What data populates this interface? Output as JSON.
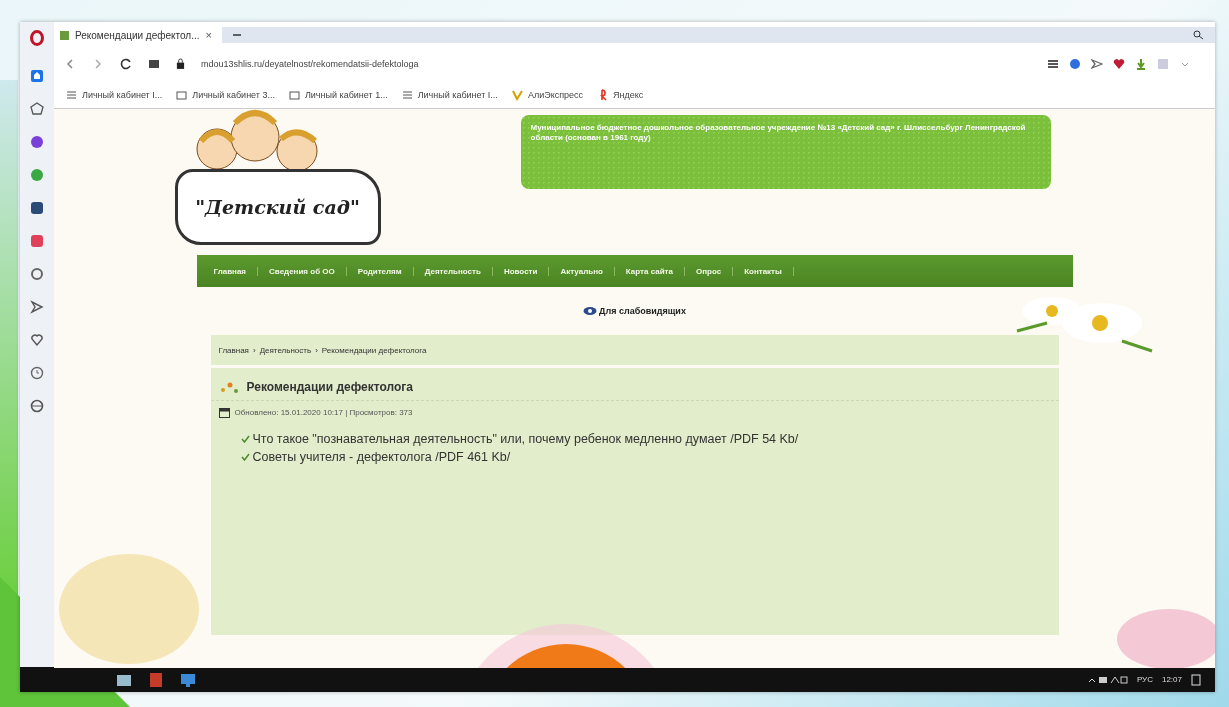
{
  "browser": {
    "tab": {
      "title": "Рекомендации дефектол...",
      "close": "×"
    },
    "address": "mdou13shlis.ru/deyatelnost/rekomendatsii-defektologa",
    "bookmarks": [
      {
        "label": "Личный кабинет I...",
        "kind": "list"
      },
      {
        "label": "Личный кабинет 3...",
        "kind": "folder"
      },
      {
        "label": "Личный кабинет 1...",
        "kind": "folder"
      },
      {
        "label": "Личный кабинет I...",
        "kind": "list"
      },
      {
        "label": "АлиЭкспресс",
        "kind": "ali"
      },
      {
        "label": "Яндекс",
        "kind": "yandex"
      }
    ]
  },
  "site": {
    "logo_text": "\"Детский сад\"",
    "org_name": "Муниципальное бюджетное дошкольное образовательное учреждение №13 «Детский сад» г. Шлиссельбург Ленинградской области (основан в 1961 году)",
    "nav": [
      {
        "label": "Главная"
      },
      {
        "label": "Сведения об ОО"
      },
      {
        "label": "Родителям"
      },
      {
        "label": "Деятельность"
      },
      {
        "label": "Новости"
      },
      {
        "label": "Актуально"
      },
      {
        "label": "Карта сайта"
      },
      {
        "label": "Опрос"
      },
      {
        "label": "Контакты"
      }
    ],
    "accessibility_link": "Для слабовидящих",
    "breadcrumbs": {
      "separator": "›",
      "items": [
        "Главная",
        "Деятельность",
        "Рекомендации дефектолога"
      ]
    },
    "article": {
      "title": "Рекомендации дефектолога",
      "meta": "Обновлено: 15.01.2020 10:17 | Просмотров: 373",
      "links": [
        "Что такое \"познавательная деятельность\" или, почему ребенок медленно думает /PDF 54 Kb/",
        "Советы учителя - дефектолога /PDF 461 Kb/"
      ]
    }
  },
  "taskbar": {
    "language": "РУС",
    "time": "12:07"
  }
}
